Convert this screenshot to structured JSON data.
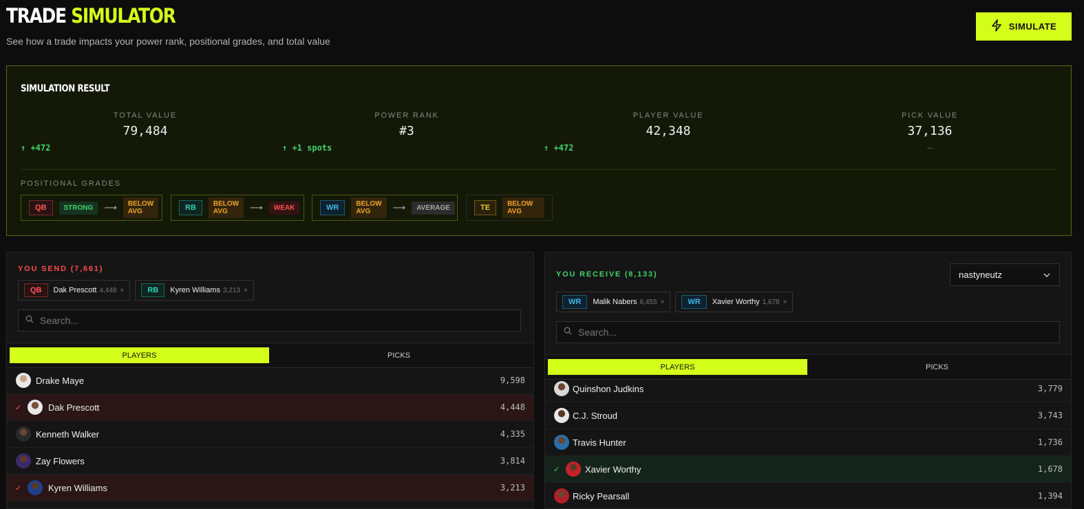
{
  "header": {
    "title_part1": "TRADE",
    "title_part2": "SIMULATOR",
    "subtitle": "See how a trade impacts your power rank, positional grades, and total value",
    "simulate_label": "SIMULATE",
    "accent_color": "#d4ff1a"
  },
  "result": {
    "title": "SIMULATION RESULT",
    "stats": [
      {
        "label": "TOTAL VALUE",
        "value": "79,484",
        "delta": "↑ +472"
      },
      {
        "label": "POWER RANK",
        "value": "#3",
        "delta": "↑ +1 spots"
      },
      {
        "label": "PLAYER VALUE",
        "value": "42,348",
        "delta": "↑ +472"
      },
      {
        "label": "PICK VALUE",
        "value": "37,136",
        "delta": "—"
      }
    ],
    "positional_grades_label": "POSITIONAL GRADES",
    "grades": [
      {
        "pos": "QB",
        "from": "STRONG",
        "arrow": "⟶",
        "to": "BELOW AVG"
      },
      {
        "pos": "RB",
        "from": "BELOW AVG",
        "arrow": "⟶",
        "to": "WEAK"
      },
      {
        "pos": "WR",
        "from": "BELOW AVG",
        "arrow": "⟶",
        "to": "AVERAGE"
      },
      {
        "pos": "TE",
        "from": "BELOW AVG"
      }
    ]
  },
  "send": {
    "heading": "YOU SEND (7,661)",
    "chips": [
      {
        "pos": "QB",
        "name": "Dak Prescott",
        "value": "4,448",
        "remove": "×"
      },
      {
        "pos": "RB",
        "name": "Kyren Williams",
        "value": "3,213",
        "remove": "×"
      }
    ],
    "search_placeholder": "Search...",
    "tabs": [
      "PLAYERS",
      "PICKS"
    ],
    "rows": [
      {
        "name": "Drake Maye",
        "value": "9,598",
        "selected": false
      },
      {
        "name": "Dak Prescott",
        "value": "4,448",
        "selected": true,
        "check": "✓"
      },
      {
        "name": "Kenneth Walker",
        "value": "4,335",
        "selected": false
      },
      {
        "name": "Zay Flowers",
        "value": "3,814",
        "selected": false
      },
      {
        "name": "Kyren Williams",
        "value": "3,213",
        "selected": true,
        "check": "✓"
      }
    ]
  },
  "receive": {
    "heading": "YOU RECEIVE (8,133)",
    "team_select": "nastyneutz",
    "chips": [
      {
        "pos": "WR",
        "name": "Malik Nabers",
        "value": "6,455",
        "remove": "×"
      },
      {
        "pos": "WR",
        "name": "Xavier Worthy",
        "value": "1,678",
        "remove": "×"
      }
    ],
    "search_placeholder": "Search...",
    "tabs": [
      "PLAYERS",
      "PICKS"
    ],
    "rows": [
      {
        "name": "Quinshon Judkins",
        "value": "3,779",
        "selected": false
      },
      {
        "name": "C.J. Stroud",
        "value": "3,743",
        "selected": false
      },
      {
        "name": "Travis Hunter",
        "value": "1,736",
        "selected": false
      },
      {
        "name": "Xavier Worthy",
        "value": "1,678",
        "selected": true,
        "check": "✓"
      },
      {
        "name": "Ricky Pearsall",
        "value": "1,394",
        "selected": false
      }
    ]
  }
}
